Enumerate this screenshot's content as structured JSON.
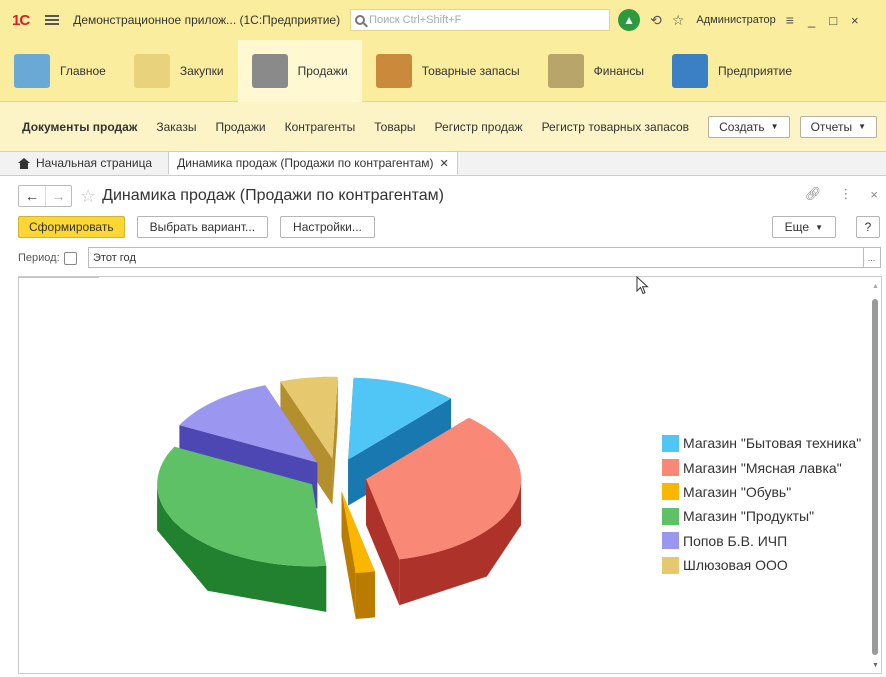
{
  "titlebar": {
    "logo": "1С",
    "title": "Демонстрационное прилож...  (1С:Предприятие)",
    "search_placeholder": "Поиск Ctrl+Shift+F",
    "user": "Администратор"
  },
  "sections": [
    {
      "label": "Главное",
      "color": "#6aa9d6"
    },
    {
      "label": "Закупки",
      "color": "#e8d27c"
    },
    {
      "label": "Продажи",
      "color": "#8a8a8a"
    },
    {
      "label": "Товарные запасы",
      "color": "#c98a3c"
    },
    {
      "label": "Финансы",
      "color": "#b7a56a"
    },
    {
      "label": "Предприятие",
      "color": "#3b7fc4"
    }
  ],
  "commands": {
    "title": "Документы продаж",
    "links": [
      "Заказы",
      "Продажи",
      "Контрагенты",
      "Товары",
      "Регистр продаж",
      "Регистр товарных запасов"
    ],
    "create_button": "Создать",
    "reports_button": "Отчеты"
  },
  "tabs": {
    "home": "Начальная страница",
    "active": "Динамика продаж (Продажи по контрагентам)"
  },
  "form": {
    "title": "Динамика продаж (Продажи по контрагентам)",
    "generate_button": "Сформировать",
    "variant_button": "Выбрать вариант...",
    "settings_button": "Настройки...",
    "more_button": "Еще",
    "help_button": "?",
    "period_label": "Период:",
    "period_value": "Этот год",
    "period_picker": "..."
  },
  "chart_data": {
    "type": "pie",
    "style": "3d-exploded",
    "legend_position": "right",
    "categories": [
      "Магазин \"Бытовая техника\"",
      "Магазин \"Мясная лавка\"",
      "Магазин \"Обувь\"",
      "Магазин \"Продукты\"",
      "Попов Б.В. ИЧП",
      "Шлюзовая ООО"
    ],
    "values": [
      11,
      35,
      2,
      34,
      12,
      6
    ],
    "colors": [
      "#4fc6f5",
      "#fa8877",
      "#fbb700",
      "#5fc165",
      "#9b97f0",
      "#e6c86e"
    ],
    "side_colors": [
      "#1a78b0",
      "#ad322a",
      "#ba7c00",
      "#21812e",
      "#4d47b4",
      "#b48f2d"
    ]
  }
}
